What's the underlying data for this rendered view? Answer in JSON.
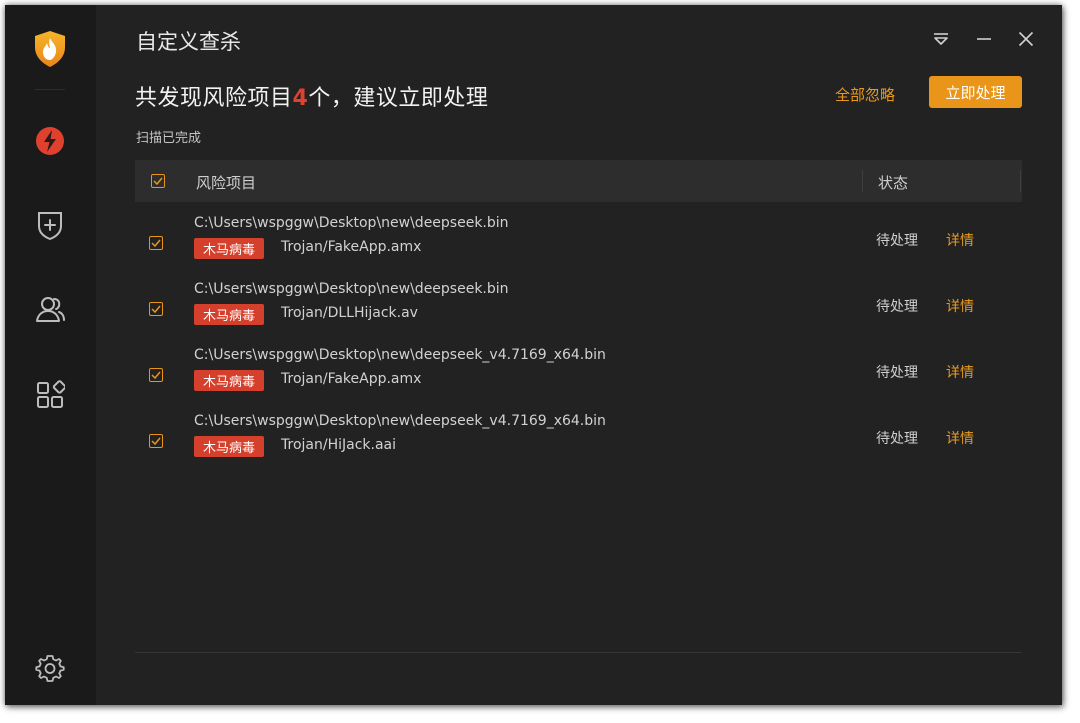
{
  "window": {
    "title": "自定义查杀"
  },
  "summary": {
    "prefix": "共发现风险项目",
    "count": "4",
    "suffix": "个，建议立即处理",
    "ignore_all_label": "全部忽略",
    "process_now_label": "立即处理",
    "scan_status": "扫描已完成"
  },
  "table": {
    "headers": {
      "risk_item": "风险项目",
      "status": "状态"
    },
    "rows": [
      {
        "path": "C:\\Users\\wspggw\\Desktop\\new\\deepseek.bin",
        "tag": "木马病毒",
        "threat": "Trojan/FakeApp.amx",
        "status": "待处理",
        "detail": "详情"
      },
      {
        "path": "C:\\Users\\wspggw\\Desktop\\new\\deepseek.bin",
        "tag": "木马病毒",
        "threat": "Trojan/DLLHijack.av",
        "status": "待处理",
        "detail": "详情"
      },
      {
        "path": "C:\\Users\\wspggw\\Desktop\\new\\deepseek_v4.7169_x64.bin",
        "tag": "木马病毒",
        "threat": "Trojan/FakeApp.amx",
        "status": "待处理",
        "detail": "详情"
      },
      {
        "path": "C:\\Users\\wspggw\\Desktop\\new\\deepseek_v4.7169_x64.bin",
        "tag": "木马病毒",
        "threat": "Trojan/HiJack.aai",
        "status": "待处理",
        "detail": "详情"
      }
    ]
  },
  "sidebar": {
    "items": [
      "flame-logo-icon",
      "lightning-icon",
      "shield-plus-icon",
      "users-icon",
      "apps-grid-icon",
      "settings-gear-icon"
    ]
  },
  "colors": {
    "accent": "#e9951a",
    "danger": "#d5402c",
    "window_bg": "#222222",
    "sidebar_bg": "#1a1a1a"
  }
}
